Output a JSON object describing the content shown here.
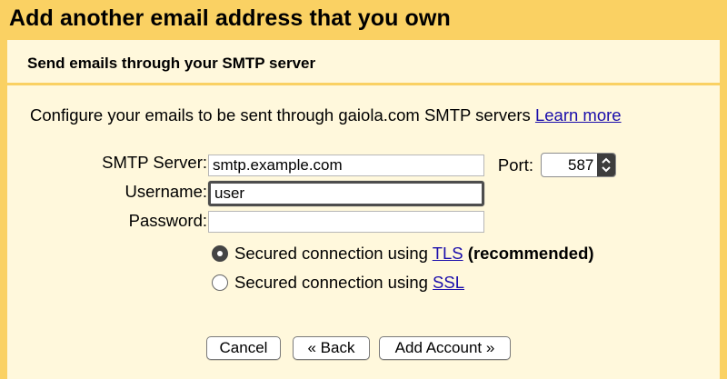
{
  "dialog": {
    "title": "Add another email address that you own"
  },
  "section": {
    "title": "Send emails through your SMTP server"
  },
  "intro": {
    "text": "Configure your emails to be sent through gaiola.com SMTP servers ",
    "link": "Learn more"
  },
  "form": {
    "smtp_label": "SMTP Server:",
    "smtp_value": "smtp.example.com",
    "port_label": "Port:",
    "port_value": "587",
    "username_label": "Username:",
    "username_value": "user",
    "password_label": "Password:",
    "password_value": ""
  },
  "security": {
    "tls_text": "Secured connection using ",
    "tls_link": "TLS",
    "tls_note": "(recommended)",
    "tls_checked": true,
    "ssl_text": "Secured connection using ",
    "ssl_link": "SSL",
    "ssl_checked": false
  },
  "buttons": {
    "cancel": "Cancel",
    "back": "« Back",
    "add_account": "Add Account »"
  },
  "colors": {
    "dialog_bg": "#fad163",
    "panel_bg": "#fff8dc",
    "link": "#1a0dab"
  }
}
